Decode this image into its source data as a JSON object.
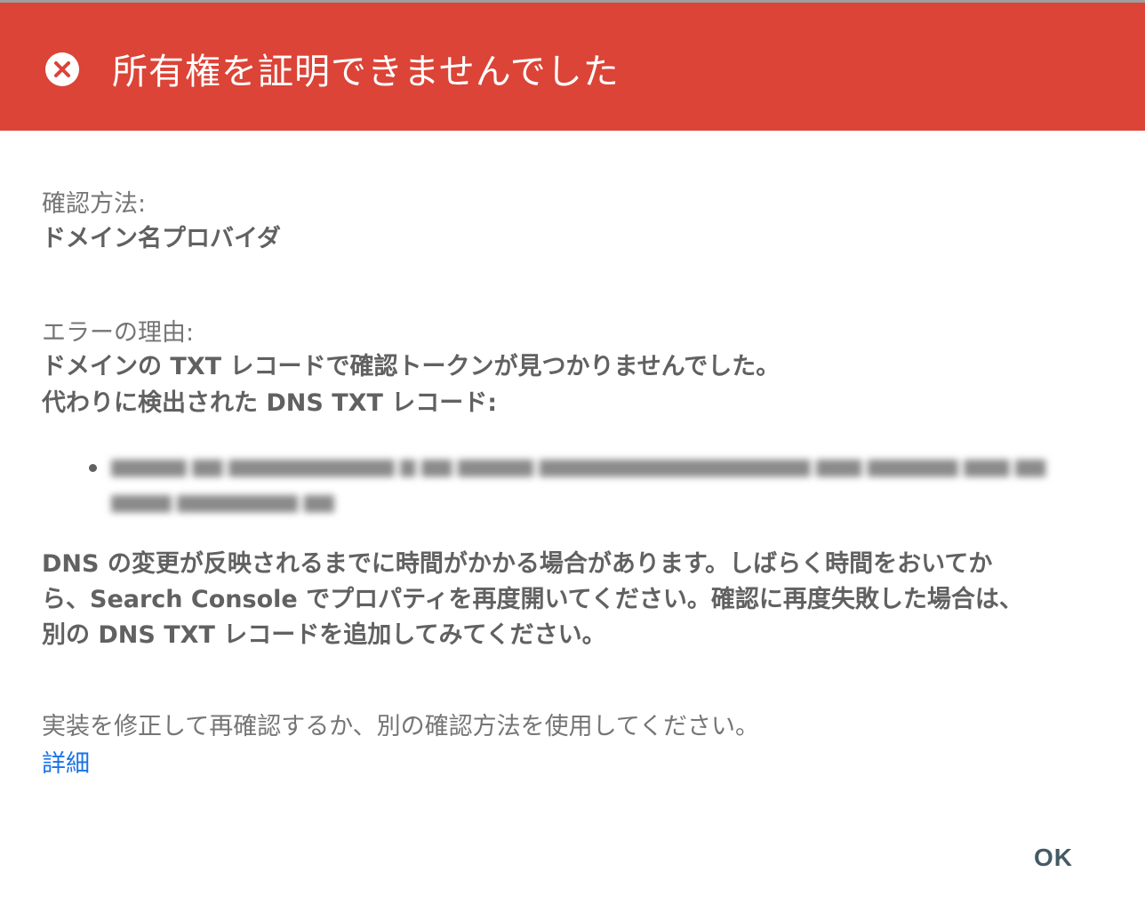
{
  "header": {
    "title": "所有権を証明できませんでした",
    "icon": "error-circle-icon",
    "bg_color": "#db4437"
  },
  "method": {
    "label": "確認方法:",
    "value": "ドメイン名プロバイダ"
  },
  "error": {
    "label": "エラーの理由:",
    "line1": "ドメインの TXT レコードで確認トークンが見つかりませんでした。",
    "line2": "代わりに検出された DNS TXT レコード:"
  },
  "note": {
    "line1": "DNS の変更が反映されるまでに時間がかかる場合があります。しばらく時間をおいてか",
    "line2": "ら、Search Console でプロパティを再度開いてください。確認に再度失敗した場合は、",
    "line3": "別の DNS TXT レコードを追加してみてください。"
  },
  "action": {
    "text": "実装を修正して再確認するか、別の確認方法を使用してください。",
    "link_label": "詳細",
    "link_color": "#1a73e8"
  },
  "footer": {
    "ok_label": "OK"
  }
}
